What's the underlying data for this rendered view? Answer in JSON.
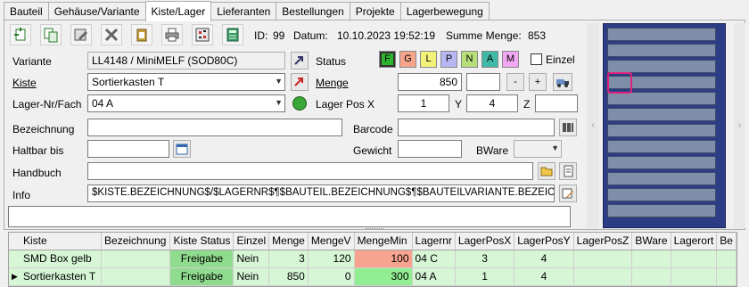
{
  "tabs": [
    "Bauteil",
    "Gehäuse/Variante",
    "Kiste/Lager",
    "Lieferanten",
    "Bestellungen",
    "Projekte",
    "Lagerbewegung"
  ],
  "header": {
    "id_label": "ID:",
    "id_value": "99",
    "date_label": "Datum:",
    "date_value": "10.10.2023 19:52:19",
    "sum_label": "Summe Menge:",
    "sum_value": "853"
  },
  "labels": {
    "variante": "Variante",
    "kiste": "Kiste",
    "lagernr": "Lager-Nr/Fach",
    "bezeichnung": "Bezeichnung",
    "haltbar": "Haltbar bis",
    "handbuch": "Handbuch",
    "info": "Info",
    "status": "Status",
    "menge": "Menge",
    "lagerpos": "Lager Pos X",
    "y": "Y",
    "z": "Z",
    "barcode": "Barcode",
    "gewicht": "Gewicht",
    "bware": "BWare",
    "einzel": "Einzel"
  },
  "fields": {
    "variante": "LL4148 / MiniMELF (SOD80C)",
    "kiste": "Sortierkasten T",
    "lagernr": "04 A",
    "menge": "850",
    "pos_x": "1",
    "pos_y": "4",
    "info": "$KISTE.BEZEICHNUNG$/$LAGERNR$¶$BAUTEIL.BEZEICHNUNG$¶$BAUTEILVARIANTE.BEZEICHNUN"
  },
  "status_letters": [
    {
      "letter": "F",
      "color": "#2db52d"
    },
    {
      "letter": "G",
      "color": "#f6a58a"
    },
    {
      "letter": "L",
      "color": "#f2f27a"
    },
    {
      "letter": "P",
      "color": "#b7b7f2"
    },
    {
      "letter": "N",
      "color": "#b7e07a"
    },
    {
      "letter": "A",
      "color": "#3fb8a8"
    },
    {
      "letter": "M",
      "color": "#f2a7f2"
    }
  ],
  "buttons": {
    "minus": "-",
    "plus": "+"
  },
  "table": {
    "columns": [
      "Kiste",
      "Bezeichnung",
      "Kiste Status",
      "Einzel",
      "Menge",
      "MengeV",
      "MengeMin",
      "Lagernr",
      "LagerPosX",
      "LagerPosY",
      "LagerPosZ",
      "BWare",
      "Lagerort",
      "Be"
    ],
    "rows": [
      [
        "SMD Box gelb",
        "",
        "Freigabe",
        "Nein",
        "3",
        "120",
        "100",
        "04 C",
        "3",
        "4",
        "",
        "",
        ""
      ],
      [
        "Sortierkasten T",
        "",
        "Freigabe",
        "Nein",
        "850",
        "0",
        "300",
        "04 A",
        "1",
        "4",
        "",
        "",
        ""
      ]
    ]
  },
  "colors": {
    "freigabe": "#8fdc8f",
    "min_low": "#f7a38f",
    "min_ok": "#92ee92",
    "row": "#d6f6d6"
  }
}
